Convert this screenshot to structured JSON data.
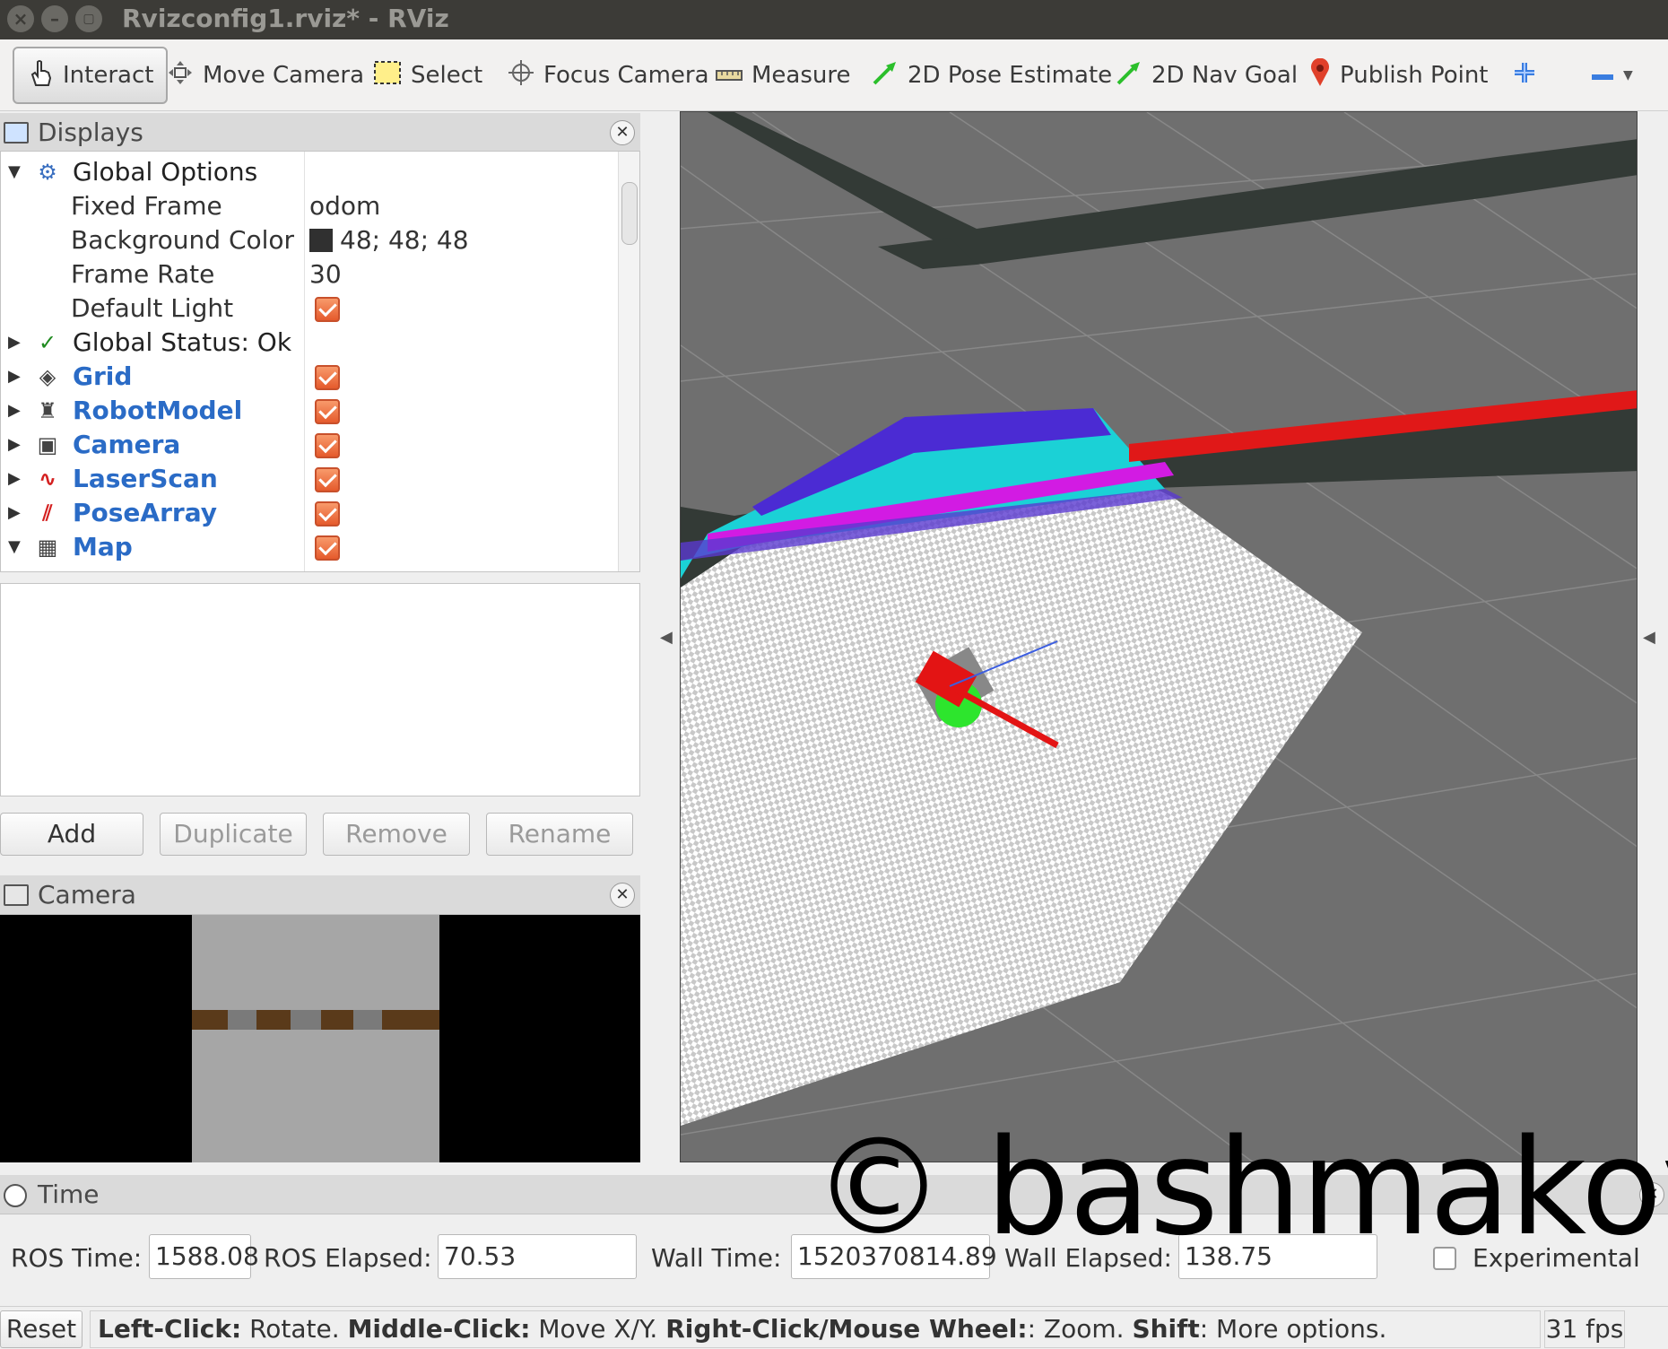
{
  "window": {
    "title": "Rvizconfig1.rviz* - RViz"
  },
  "toolbar": {
    "interact": "Interact",
    "move_camera": "Move Camera",
    "select": "Select",
    "focus_camera": "Focus Camera",
    "measure": "Measure",
    "pose_estimate": "2D Pose Estimate",
    "nav_goal": "2D Nav Goal",
    "publish_point": "Publish Point"
  },
  "displays": {
    "title": "Displays",
    "items": [
      {
        "label": "Global Options",
        "icon": "gear-icon"
      },
      {
        "label": "Fixed Frame",
        "value": "odom"
      },
      {
        "label": "Background Color",
        "value": "48; 48; 48",
        "color": "#303030"
      },
      {
        "label": "Frame Rate",
        "value": "30"
      },
      {
        "label": "Default Light",
        "checked": true
      },
      {
        "label": "Global Status: Ok",
        "icon": "check-icon"
      },
      {
        "label": "Grid",
        "icon": "grid-icon",
        "checked": true
      },
      {
        "label": "RobotModel",
        "icon": "robot-icon",
        "checked": true
      },
      {
        "label": "Camera",
        "icon": "camera-icon",
        "checked": true
      },
      {
        "label": "LaserScan",
        "icon": "laserscan-icon",
        "checked": true
      },
      {
        "label": "PoseArray",
        "icon": "posearray-icon",
        "checked": true
      },
      {
        "label": "Map",
        "icon": "map-icon",
        "checked": true
      }
    ],
    "buttons": {
      "add": "Add",
      "duplicate": "Duplicate",
      "remove": "Remove",
      "rename": "Rename"
    }
  },
  "camera_panel": {
    "title": "Camera"
  },
  "time_panel": {
    "title": "Time",
    "ros_time_label": "ROS Time:",
    "ros_time": "1588.08",
    "ros_elapsed_label": "ROS Elapsed:",
    "ros_elapsed": "70.53",
    "wall_time_label": "Wall Time:",
    "wall_time": "1520370814.89",
    "wall_elapsed_label": "Wall Elapsed:",
    "wall_elapsed": "138.75",
    "experimental_label": "Experimental",
    "experimental": false
  },
  "statusbar": {
    "reset": "Reset",
    "help_left_click": "Left-Click:",
    "help_rotate": " Rotate. ",
    "help_middle_click": "Middle-Click:",
    "help_move": " Move X/Y. ",
    "help_right_click": "Right-Click/Mouse Wheel:",
    "help_zoom": ": Zoom. ",
    "help_shift": "Shift",
    "help_more": ": More options.",
    "fps": "31 fps"
  },
  "watermark": "© bashmakov"
}
